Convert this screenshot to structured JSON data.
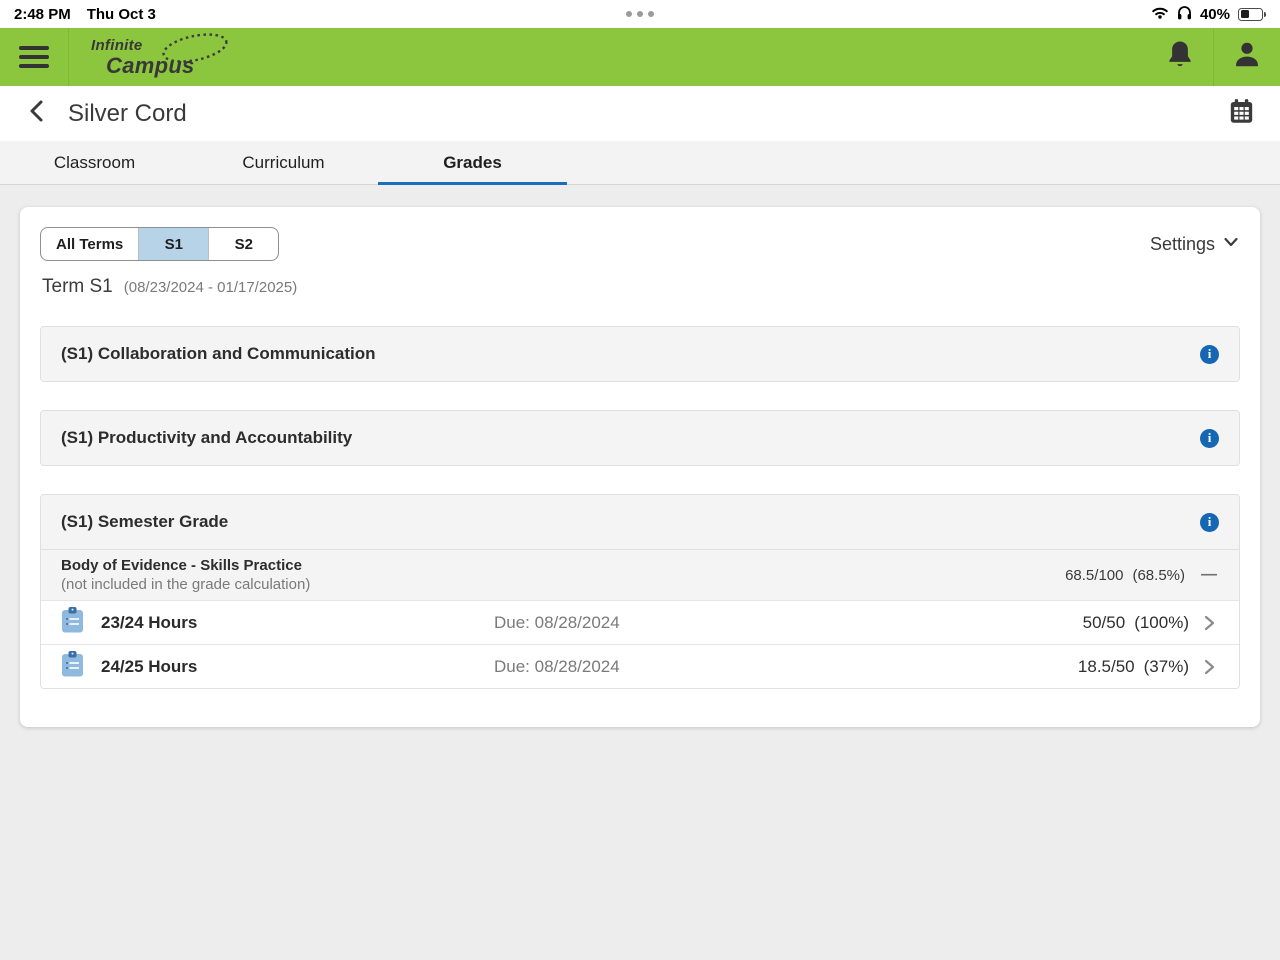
{
  "status_bar": {
    "time": "2:48 PM",
    "date": "Thu Oct 3",
    "battery_percent": "40%"
  },
  "app_header": {
    "logo_top": "Infinite",
    "logo_bottom": "Campus"
  },
  "title_bar": {
    "title": "Silver Cord"
  },
  "tabs": {
    "items": [
      {
        "label": "Classroom"
      },
      {
        "label": "Curriculum"
      },
      {
        "label": "Grades"
      }
    ],
    "active_index": 2
  },
  "grades_panel": {
    "term_filters": [
      {
        "label": "All Terms"
      },
      {
        "label": "S1"
      },
      {
        "label": "S2"
      }
    ],
    "selected_term_index": 1,
    "settings_label": "Settings",
    "term_heading": "Term S1",
    "term_range": "(08/23/2024 - 01/17/2025)",
    "sections": [
      {
        "title": "(S1) Collaboration and Communication"
      },
      {
        "title": "(S1) Productivity and Accountability"
      },
      {
        "title": "(S1) Semester Grade",
        "category": {
          "name": "Body of Evidence - Skills Practice",
          "note": "(not included in the grade calculation)",
          "score": "68.5/100",
          "percent": "(68.5%)",
          "dash": "—"
        },
        "assignments": [
          {
            "name": "23/24 Hours",
            "due": "Due: 08/28/2024",
            "score": "50/50",
            "percent": "(100%)"
          },
          {
            "name": "24/25 Hours",
            "due": "Due: 08/28/2024",
            "score": "18.5/50",
            "percent": "(37%)"
          }
        ]
      }
    ]
  },
  "icons": {
    "wifi": "wifi-icon",
    "headphones": "headphones-icon",
    "battery": "battery-icon",
    "menu": "hamburger-menu-icon",
    "bell": "notification-bell-icon",
    "person": "user-person-icon",
    "back": "back-chevron-icon",
    "calendar": "calendar-icon",
    "info": "info-icon",
    "assignment": "clipboard-assignment-icon",
    "chevron_right": "chevron-right-icon",
    "chevron_down": "chevron-down-icon"
  },
  "colors": {
    "header_green": "#8cc63f",
    "tab_underline_blue": "#1b6ebc",
    "info_blue": "#1567b3",
    "selected_term_blue": "#b7d3e8"
  }
}
